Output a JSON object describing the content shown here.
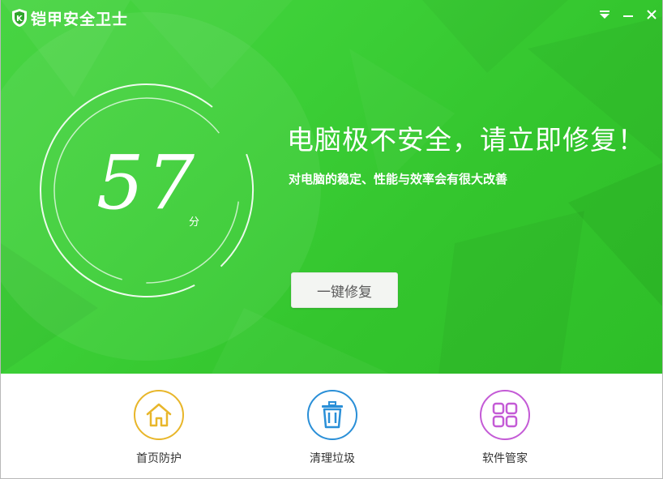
{
  "app": {
    "title": "铠甲安全卫士"
  },
  "window_controls": {
    "menu_icon": "menu-arrow-icon",
    "minimize_icon": "minimize-icon",
    "close_icon": "close-icon"
  },
  "score": {
    "value": "57",
    "unit": "分"
  },
  "status": {
    "headline": "电脑极不安全，请立即修复！",
    "subline": "对电脑的稳定、性能与效率会有很大改善"
  },
  "actions": {
    "fix_label": "一键修复"
  },
  "nav": [
    {
      "label": "首页防护",
      "icon": "home-icon",
      "color": "#e8b62a"
    },
    {
      "label": "清理垃圾",
      "icon": "trash-icon",
      "color": "#2a8fd7"
    },
    {
      "label": "软件管家",
      "icon": "apps-grid-icon",
      "color": "#c45bd6"
    }
  ],
  "colors": {
    "hero_green": "#3ccf37",
    "white": "#ffffff"
  }
}
